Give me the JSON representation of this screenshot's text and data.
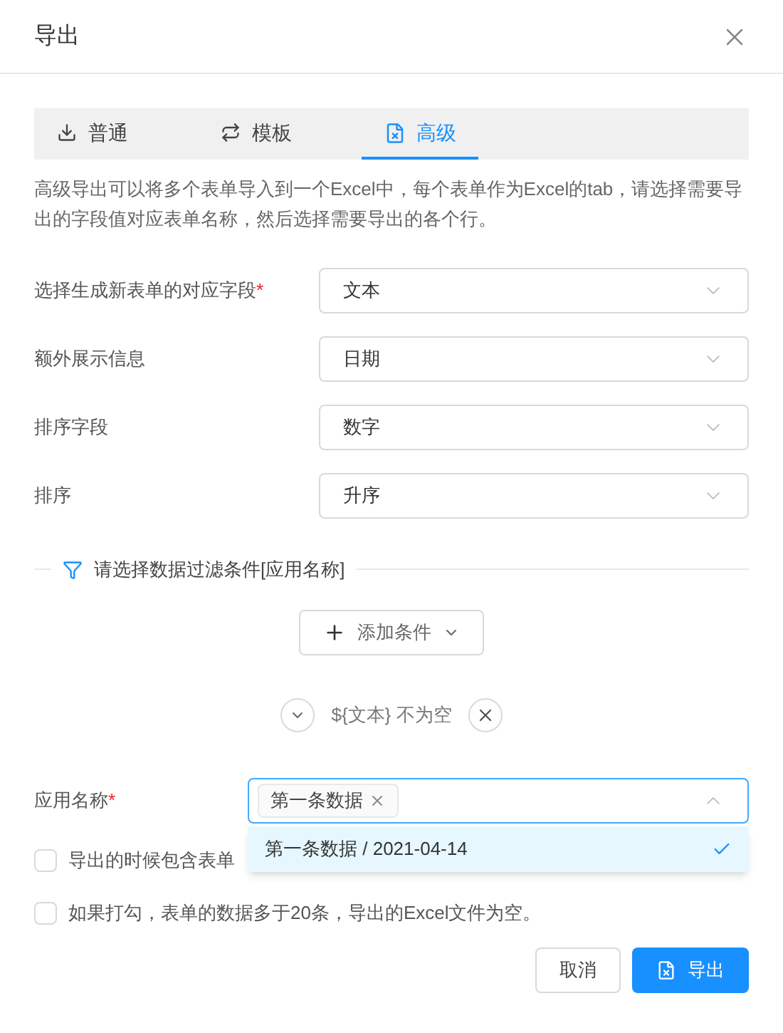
{
  "dialog": {
    "title": "导出"
  },
  "tabs": [
    {
      "label": "普通",
      "selected": false
    },
    {
      "label": "模板",
      "selected": false
    },
    {
      "label": "高级",
      "selected": true
    }
  ],
  "description": "高级导出可以将多个表单导入到一个Excel中，每个表单作为Excel的tab，请选择需要导出的字段值对应表单名称，然后选择需要导出的各个行。",
  "fields": [
    {
      "label": "选择生成新表单的对应字段",
      "required_mark": "*",
      "value": "文本"
    },
    {
      "label": "额外展示信息",
      "value": "日期"
    },
    {
      "label": "排序字段",
      "value": "数字"
    },
    {
      "label": "排序",
      "value": "升序"
    }
  ],
  "filter": {
    "title": "请选择数据过滤条件[应用名称]",
    "add_button": "添加条件",
    "condition": "${文本} 不为空"
  },
  "app_field": {
    "label": "应用名称",
    "required_mark": "*",
    "tags": [
      "第一条数据"
    ],
    "expanded": true,
    "options": [
      {
        "label": "第一条数据 / 2021-04-14",
        "selected": true
      }
    ]
  },
  "checkboxes": [
    {
      "label": "导出的时候包含表单",
      "checked": false
    },
    {
      "label": "如果打勾，表单的数据多于20条，导出的Excel文件为空。",
      "checked": false
    }
  ],
  "buttons": [
    {
      "label": "取消",
      "kind": "default"
    },
    {
      "label": "导出",
      "kind": "primary"
    }
  ]
}
